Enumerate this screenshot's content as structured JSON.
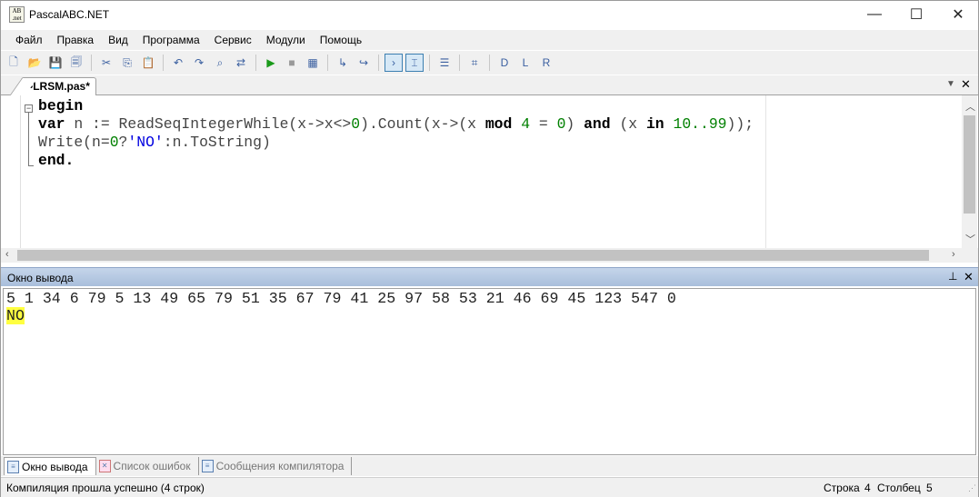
{
  "window": {
    "title": "PascalABC.NET",
    "icon_text": "AB .net",
    "minimize": "—",
    "maximize": "☐",
    "close": "✕"
  },
  "menu": [
    "Файл",
    "Правка",
    "Вид",
    "Программа",
    "Сервис",
    "Модули",
    "Помощь"
  ],
  "toolbar": [
    {
      "name": "new-file-icon",
      "g": "🗋"
    },
    {
      "name": "open-icon",
      "g": "📂"
    },
    {
      "name": "save-icon",
      "g": "💾"
    },
    {
      "name": "save-all-icon",
      "g": "🗐"
    },
    "sep",
    {
      "name": "cut-icon",
      "g": "✂"
    },
    {
      "name": "copy-icon",
      "g": "⎘"
    },
    {
      "name": "paste-icon",
      "g": "📋"
    },
    "sep",
    {
      "name": "undo-icon",
      "g": "↶"
    },
    {
      "name": "redo-icon",
      "g": "↷"
    },
    {
      "name": "find-icon",
      "g": "⌕"
    },
    {
      "name": "replace-icon",
      "g": "⇄"
    },
    "sep",
    {
      "name": "run-icon",
      "g": "▶",
      "c": "#1a9a1a"
    },
    {
      "name": "stop-icon",
      "g": "■",
      "c": "#999"
    },
    {
      "name": "compile-icon",
      "g": "▦"
    },
    "sep",
    {
      "name": "step-into-icon",
      "g": "↳"
    },
    {
      "name": "step-over-icon",
      "g": "↪"
    },
    "sep",
    {
      "name": "console-icon",
      "g": "›",
      "a": true
    },
    {
      "name": "output-window-icon",
      "g": "⌶",
      "a": true
    },
    "sep",
    {
      "name": "document-icon",
      "g": "☰"
    },
    "sep",
    {
      "name": "code-icon",
      "g": "⌗"
    },
    "sep",
    {
      "name": "module-d-icon",
      "g": "D"
    },
    {
      "name": "module-l-icon",
      "g": "L"
    },
    {
      "name": "module-r-icon",
      "g": "R"
    }
  ],
  "tab": {
    "label": "•LRSM.pas*",
    "menu": "▼",
    "close": "✕"
  },
  "editor": {
    "lines": [
      [
        {
          "t": "begin",
          "c": "kw"
        }
      ],
      [
        {
          "t": "var",
          "c": "kw"
        },
        {
          "t": " n := ReadSeqIntegerWhile(x->x<>"
        },
        {
          "t": "0",
          "c": "num"
        },
        {
          "t": ").Count(x->(x "
        },
        {
          "t": "mod",
          "c": "kw"
        },
        {
          "t": " "
        },
        {
          "t": "4",
          "c": "num"
        },
        {
          "t": " = "
        },
        {
          "t": "0",
          "c": "num"
        },
        {
          "t": ") "
        },
        {
          "t": "and",
          "c": "kw"
        },
        {
          "t": " (x "
        },
        {
          "t": "in",
          "c": "kw"
        },
        {
          "t": " "
        },
        {
          "t": "10..99",
          "c": "num"
        },
        {
          "t": "));"
        }
      ],
      [
        {
          "t": "Write(n="
        },
        {
          "t": "0",
          "c": "num"
        },
        {
          "t": "?"
        },
        {
          "t": "'NO'",
          "c": "str"
        },
        {
          "t": ":n.ToString)"
        }
      ],
      [
        {
          "t": "end.",
          "c": "kw"
        }
      ]
    ]
  },
  "output_panel": {
    "title": "Окно вывода",
    "pin": "⊥",
    "close": "✕",
    "input_line": "5 1 34 6 79 5 13 49 65 79 51 35 67 79 41 25 97 58 53 21 46 69 45 123 547 0",
    "result": "NO"
  },
  "bottom_tabs": [
    {
      "label": "Окно вывода",
      "icon": "output-list-icon",
      "active": true
    },
    {
      "label": "Список ошибок",
      "icon": "error-list-icon",
      "active": false
    },
    {
      "label": "Сообщения компилятора",
      "icon": "compiler-messages-icon",
      "active": false
    }
  ],
  "status": {
    "message": "Компиляция прошла успешно (4 строк)",
    "row_label": "Строка",
    "row": "4",
    "col_label": "Столбец",
    "col": "5"
  }
}
